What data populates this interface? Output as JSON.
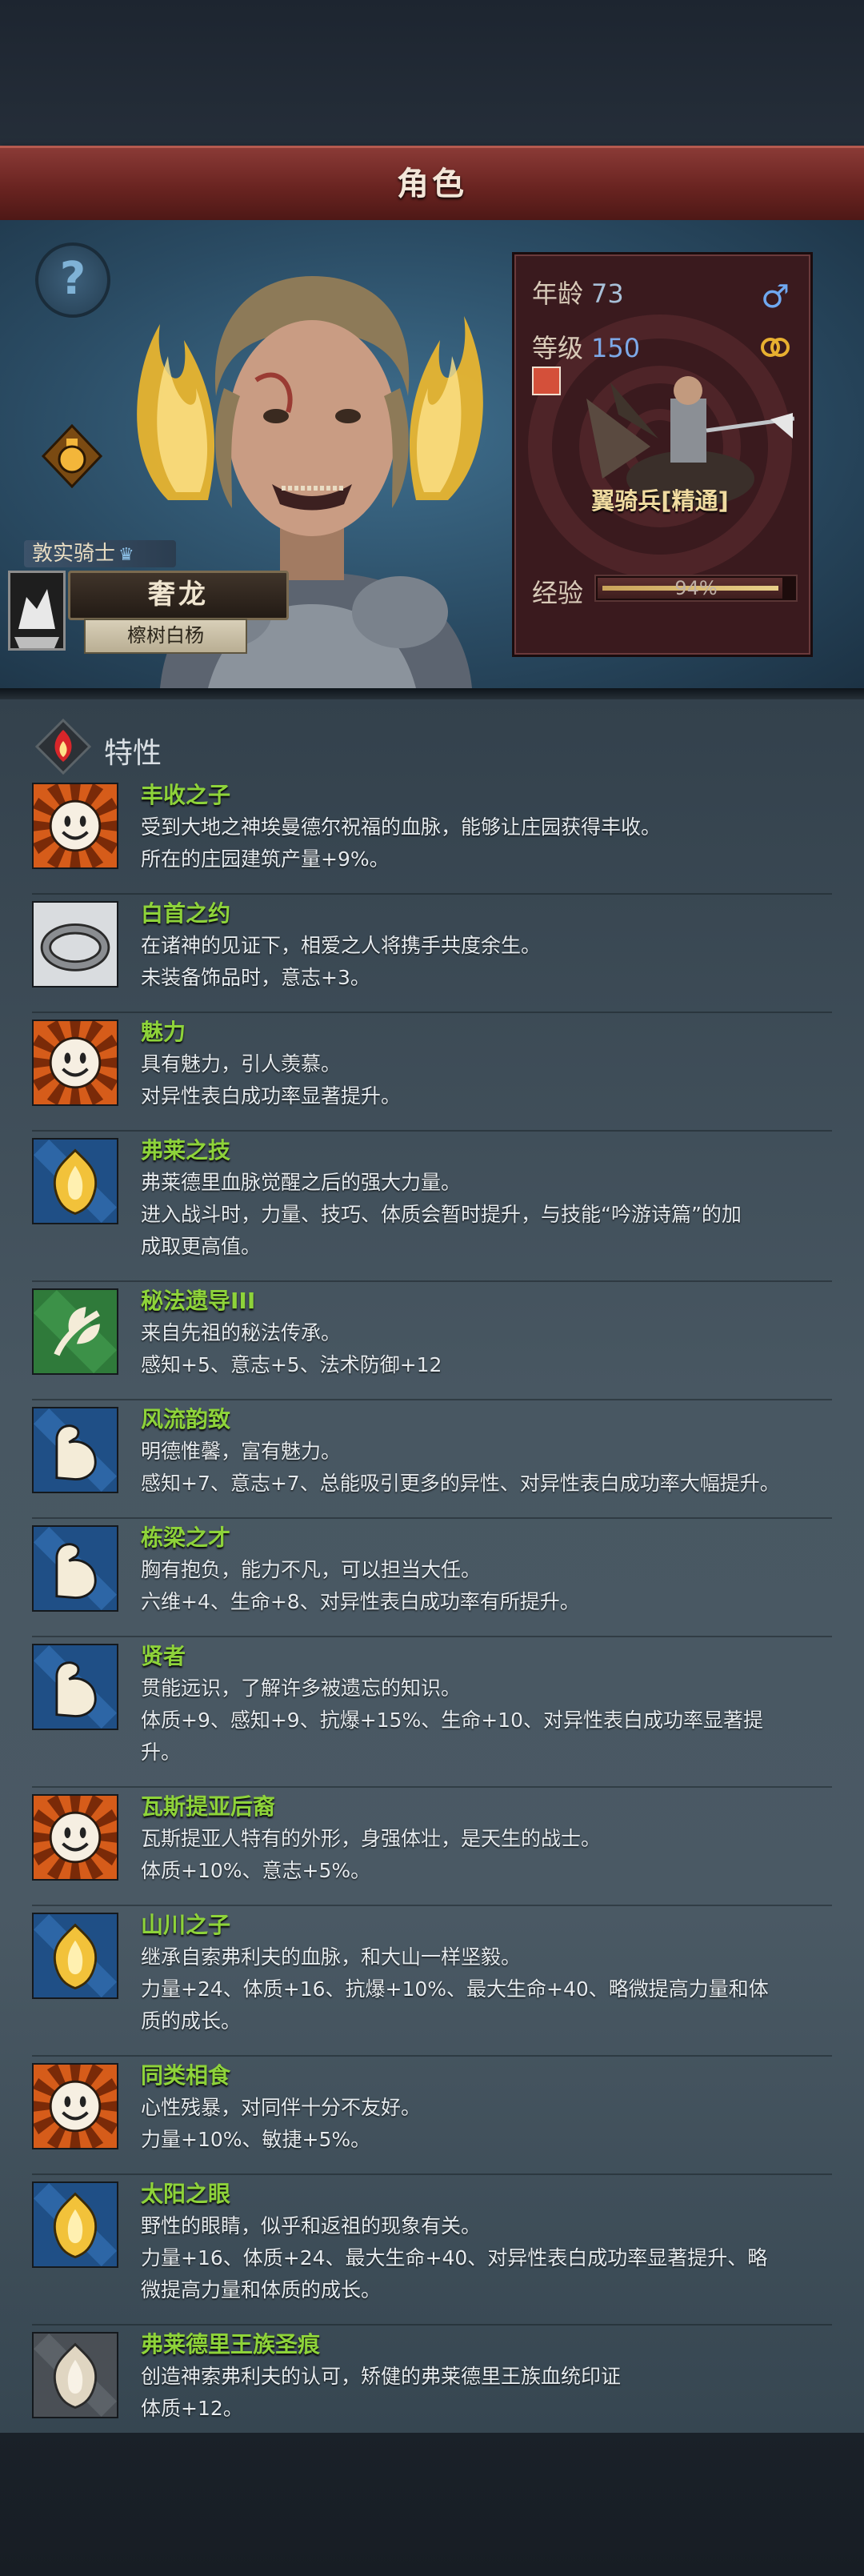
{
  "title": "角色",
  "character": {
    "rank": "敦实骑士",
    "name": "奢龙",
    "origin": "檫树白杨",
    "age_label": "年龄",
    "age": "73",
    "level_label": "等级",
    "level": "150",
    "unit": "翼骑兵[精通]",
    "xp_label": "经验",
    "xp_percent": "94%",
    "xp_fraction": 0.94
  },
  "icons": {
    "help": "question-mark-icon",
    "potion": "potion-icon",
    "gender": "male-symbol-icon",
    "ring": "wedding-ring-icon",
    "traits": "flame-diamond-icon"
  },
  "traits_title": "特性",
  "traits": [
    {
      "name": "丰收之子",
      "icon": "smiley-sun",
      "lines": [
        "受到大地之神埃曼德尔祝福的血脉，能够让庄园获得丰收。",
        "所在的庄园建筑产量+9%。"
      ]
    },
    {
      "name": "白首之约",
      "icon": "ring",
      "lines": [
        "在诸神的见证下，相爱之人将携手共度余生。",
        "未装备饰品时，意志+3。"
      ]
    },
    {
      "name": "魅力",
      "icon": "smiley-sun",
      "lines": [
        "具有魅力，引人羡慕。",
        "对异性表白成功率显著提升。"
      ]
    },
    {
      "name": "弗莱之技",
      "icon": "fire-crest",
      "lines": [
        "弗莱德里血脉觉醒之后的强大力量。",
        "进入战斗时，力量、技巧、体质会暂时提升，与技能“吟游诗篇”的加",
        "成取更高值。"
      ]
    },
    {
      "name": "秘法遗导III",
      "icon": "leaf",
      "lines": [
        "来自先祖的秘法传承。",
        "感知+5、意志+5、法术防御+12"
      ]
    },
    {
      "name": "风流韵致",
      "icon": "muscle",
      "lines": [
        "明德惟馨，富有魅力。",
        "感知+7、意志+7、总能吸引更多的异性、对异性表白成功率大幅提升。"
      ]
    },
    {
      "name": "栋梁之才",
      "icon": "muscle",
      "lines": [
        "胸有抱负，能力不凡，可以担当大任。",
        "六维+4、生命+8、对异性表白成功率有所提升。"
      ]
    },
    {
      "name": "贤者",
      "icon": "muscle",
      "lines": [
        "贯能远识，了解许多被遗忘的知识。",
        "体质+9、感知+9、抗爆+15%、生命+10、对异性表白成功率显著提",
        "升。"
      ]
    },
    {
      "name": "瓦斯提亚后裔",
      "icon": "smiley-sun",
      "lines": [
        "瓦斯提亚人特有的外形，身强体壮，是天生的战士。",
        "体质+10%、意志+5%。"
      ]
    },
    {
      "name": "山川之子",
      "icon": "fire-crest",
      "lines": [
        "继承自索弗利夫的血脉，和大山一样坚毅。",
        "力量+24、体质+16、抗爆+10%、最大生命+40、略微提高力量和体",
        "质的成长。"
      ]
    },
    {
      "name": "同类相食",
      "icon": "smiley-sun",
      "lines": [
        "心性残暴，对同伴十分不友好。",
        "力量+10%、敏捷+5%。"
      ]
    },
    {
      "name": "太阳之眼",
      "icon": "fire-crest",
      "lines": [
        "野性的眼睛，似乎和返祖的现象有关。",
        "力量+16、体质+24、最大生命+40、对异性表白成功率显著提升、略",
        "微提高力量和体质的成长。"
      ]
    },
    {
      "name": "弗莱德里王族圣痕",
      "icon": "grey-crest",
      "lines": [
        "创造神索弗利夫的认可，矫健的弗莱德里王族血统印证",
        "体质+12。"
      ]
    }
  ]
}
